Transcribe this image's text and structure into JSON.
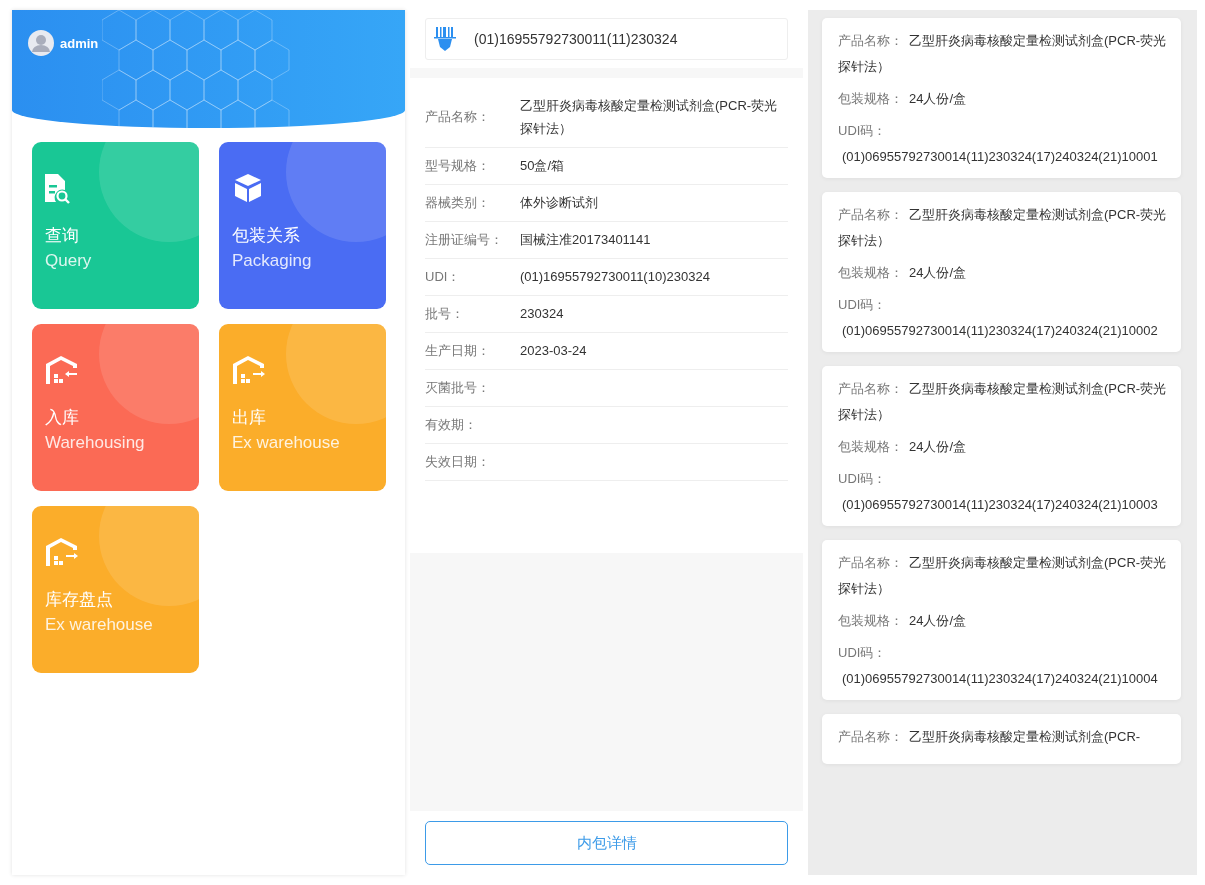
{
  "user": {
    "name": "admin"
  },
  "tiles": [
    {
      "title": "查询",
      "subtitle": "Query",
      "kind": "query",
      "color": "#19c795"
    },
    {
      "title": "包装关系",
      "subtitle": "Packaging",
      "kind": "package",
      "color": "#4a6cf3"
    },
    {
      "title": "入库",
      "subtitle": "Warehousing",
      "kind": "inbound",
      "color": "#fb6a55"
    },
    {
      "title": "出库",
      "subtitle": "Ex warehouse",
      "kind": "outbound",
      "color": "#fbad2a"
    },
    {
      "title": "库存盘点",
      "subtitle": "Ex warehouse",
      "kind": "outbound",
      "color": "#fbad2a"
    }
  ],
  "scan": {
    "value": "(01)16955792730011(11)230324"
  },
  "details": [
    {
      "label": "产品名称：",
      "value": "乙型肝炎病毒核酸定量检测试剂盒(PCR-荧光探针法）"
    },
    {
      "label": "型号规格：",
      "value": "50盒/箱"
    },
    {
      "label": "器械类别：",
      "value": "体外诊断试剂"
    },
    {
      "label": "注册证编号：",
      "value": "国械注准20173401141"
    },
    {
      "label": "UDI：",
      "value": "(01)16955792730011(10)230324"
    },
    {
      "label": "批号：",
      "value": "230324"
    },
    {
      "label": "生产日期：",
      "value": "2023-03-24"
    },
    {
      "label": "灭菌批号："
    },
    {
      "label": "有效期："
    },
    {
      "label": "失效日期："
    }
  ],
  "detail_button": "内包详情",
  "packages": [
    {
      "name_label": "产品名称：",
      "name": "乙型肝炎病毒核酸定量检测试剂盒(PCR-荧光探针法）",
      "spec_label": "包装规格：",
      "spec": "24人份/盒",
      "udi_label": "UDI码：",
      "udi": "(01)06955792730014(11)230324(17)240324(21)10001"
    },
    {
      "name_label": "产品名称：",
      "name": "乙型肝炎病毒核酸定量检测试剂盒(PCR-荧光探针法）",
      "spec_label": "包装规格：",
      "spec": "24人份/盒",
      "udi_label": "UDI码：",
      "udi": "(01)06955792730014(11)230324(17)240324(21)10002"
    },
    {
      "name_label": "产品名称：",
      "name": "乙型肝炎病毒核酸定量检测试剂盒(PCR-荧光探针法）",
      "spec_label": "包装规格：",
      "spec": "24人份/盒",
      "udi_label": "UDI码：",
      "udi": "(01)06955792730014(11)230324(17)240324(21)10003"
    },
    {
      "name_label": "产品名称：",
      "name": "乙型肝炎病毒核酸定量检测试剂盒(PCR-荧光探针法）",
      "spec_label": "包装规格：",
      "spec": "24人份/盒",
      "udi_label": "UDI码：",
      "udi": "(01)06955792730014(11)230324(17)240324(21)10004"
    },
    {
      "name_label": "产品名称：",
      "name": "乙型肝炎病毒核酸定量检测试剂盒(PCR-"
    }
  ]
}
